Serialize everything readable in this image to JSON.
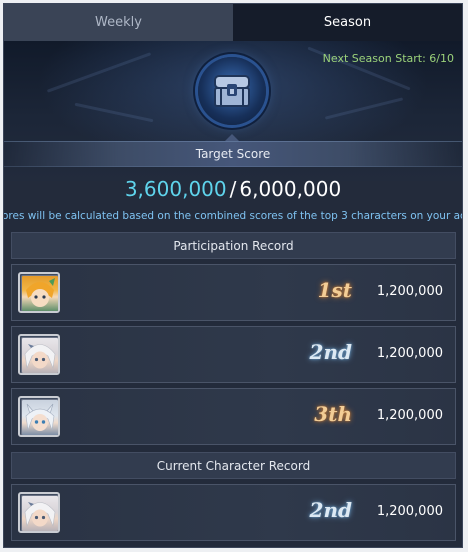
{
  "tabs": [
    {
      "label": "Weekly",
      "active": false
    },
    {
      "label": "Season",
      "active": true
    }
  ],
  "next_season_start": "Next Season Start: 6/10",
  "target": {
    "label": "Target Score",
    "current": "3,600,000",
    "separator": "/",
    "goal": "6,000,000"
  },
  "description": "ores will be calculated based on the combined scores of the top 3 characters on your accou",
  "participation": {
    "header": "Participation Record",
    "rows": [
      {
        "rank": "1st",
        "score": "1,200,000",
        "character": "blonde-hair-character",
        "rank_color": "gold"
      },
      {
        "rank": "2nd",
        "score": "1,200,000",
        "character": "white-hair-character",
        "rank_color": "silver"
      },
      {
        "rank": "3th",
        "score": "1,200,000",
        "character": "silver-cat-ear-character",
        "rank_color": "gold"
      }
    ]
  },
  "current": {
    "header": "Current Character Record",
    "rows": [
      {
        "rank": "2nd",
        "score": "1,200,000",
        "character": "white-hair-character",
        "rank_color": "silver"
      }
    ]
  },
  "colors": {
    "accent_score": "#5fd4ec",
    "next_season": "#9bd27a",
    "description": "#7fc3f2",
    "panel_bg": "#232b3b"
  }
}
